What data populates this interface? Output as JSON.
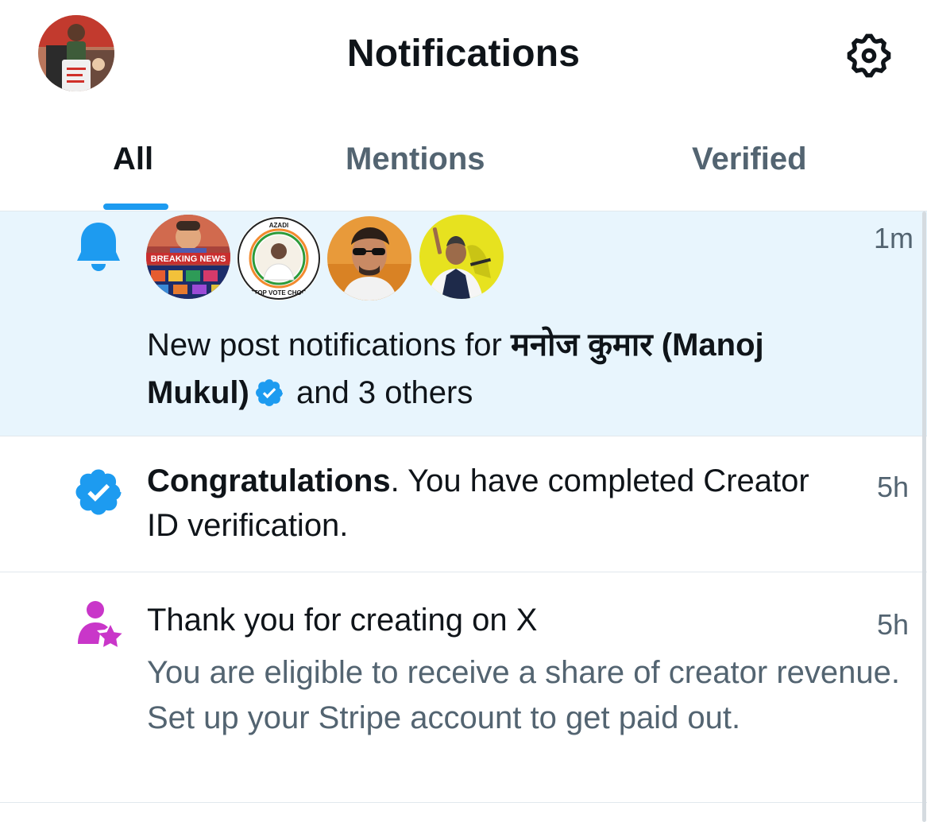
{
  "header": {
    "title": "Notifications",
    "avatar_icon": "user-avatar",
    "settings_icon": "gear-icon"
  },
  "tabs": [
    {
      "label": "All",
      "active": true
    },
    {
      "label": "Mentions",
      "active": false
    },
    {
      "label": "Verified",
      "active": false
    }
  ],
  "colors": {
    "accent": "#1d9bf0",
    "highlight_bg": "#e8f5fd",
    "secondary_text": "#536471",
    "creator_icon": "#c936c9"
  },
  "notifications": [
    {
      "type": "new-post",
      "icon": "bell-icon",
      "time": "1m",
      "text_prefix": "New post notifications for ",
      "account_name": "मनोज कुमार (Manoj Mukul)",
      "verified_icon": "verified-badge-icon",
      "text_suffix": " and 3 others",
      "avatars": [
        "avatar-breaking-news",
        "avatar-stop-vote-chori",
        "avatar-man-sunglasses",
        "avatar-man-yellow-bg"
      ],
      "avatar_texts": [
        "BREAKING NEWS",
        "AZADI",
        "STOP VOTE CHORI"
      ]
    },
    {
      "type": "verification",
      "icon": "verified-badge-icon",
      "time": "5h",
      "bold": "Congratulations",
      "text": ".  You have completed Creator ID verification."
    },
    {
      "type": "creator",
      "icon": "person-star-icon",
      "time": "5h",
      "title": "Thank you for creating on X",
      "body": "You are eligible to receive a share of creator revenue. Set up your Stripe account to get paid out."
    }
  ]
}
